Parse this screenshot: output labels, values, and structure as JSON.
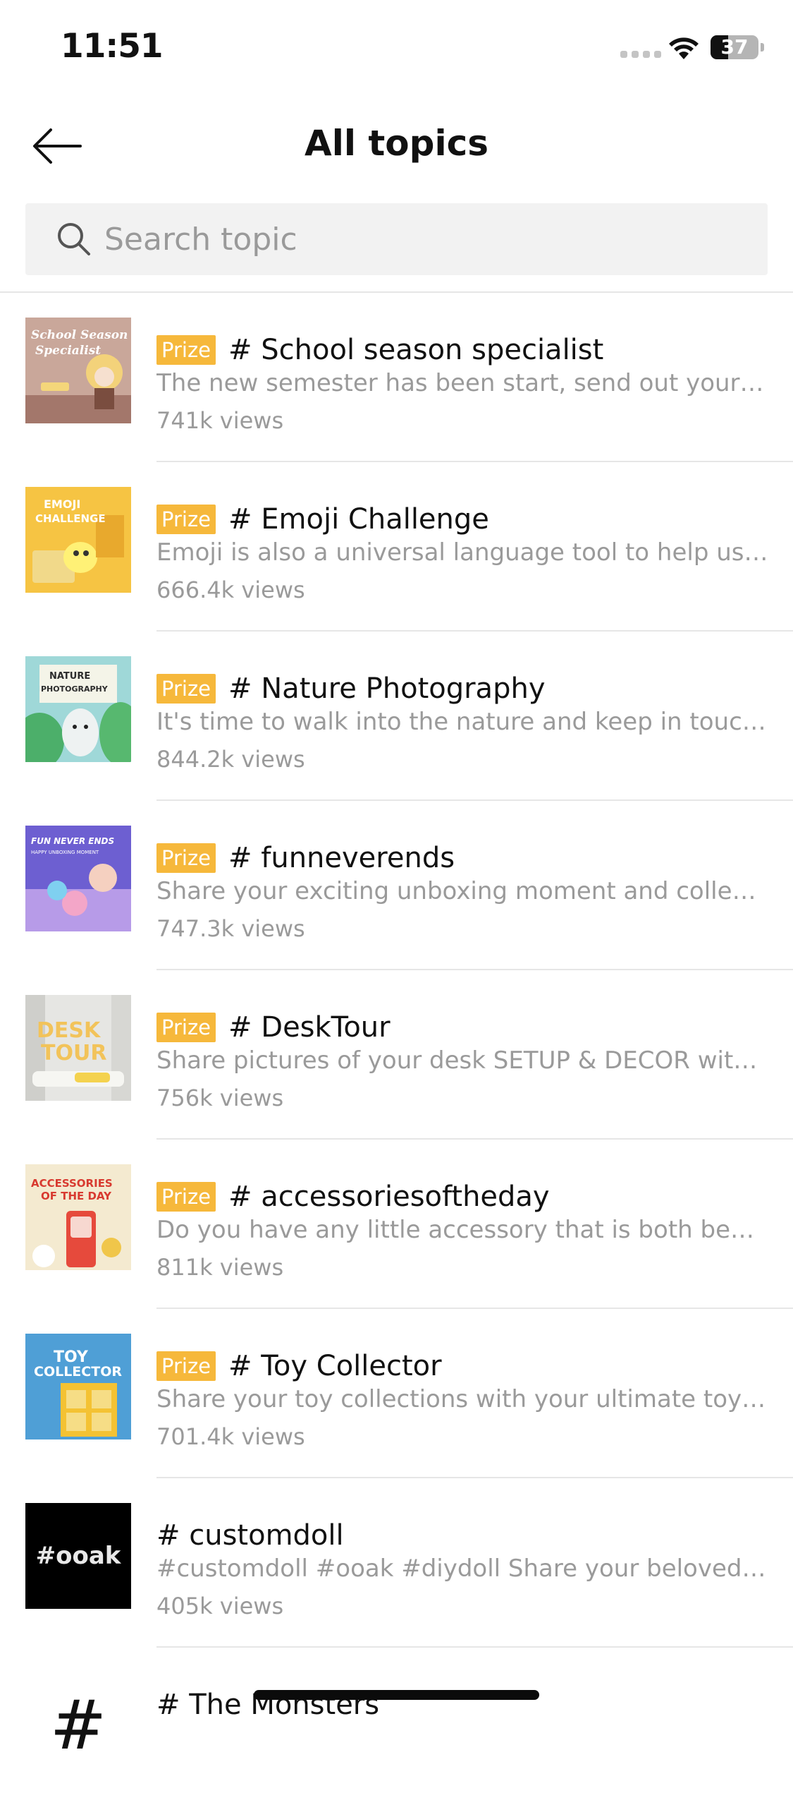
{
  "status_bar": {
    "time": "11:51",
    "battery_level": "37"
  },
  "header": {
    "title": "All topics"
  },
  "search": {
    "placeholder": "Search topic",
    "value": ""
  },
  "colors": {
    "prize_badge": "#f6b83b",
    "secondary_text": "#9a9a9a",
    "divider": "#e6e6e6"
  },
  "topics": [
    {
      "prize": "Prize",
      "title": "# School season specialist",
      "description": "The new semester has been start, send out your first plan for the new semester",
      "views": "741k views",
      "thumb_text": [
        "School Season",
        "Specialist"
      ]
    },
    {
      "prize": "Prize",
      "title": "# Emoji Challenge",
      "description": "Emoji is also a universal language tool to help us express our feelings",
      "views": "666.4k views",
      "thumb_text": [
        "EMOJI",
        "CHALLENGE"
      ]
    },
    {
      "prize": "Prize",
      "title": "# Nature Photography",
      "description": "It's time to walk into the nature and keep in touch with the world around",
      "views": "844.2k views",
      "thumb_text": [
        "NATURE",
        "PHOTOGRAPHY"
      ]
    },
    {
      "prize": "Prize",
      "title": "# funneverends",
      "description": "Share your exciting unboxing moment and collectible moments with us",
      "views": "747.3k views",
      "thumb_text": [
        "FUN NEVER ENDS",
        "HAPPY UNBOXING MOMENT"
      ]
    },
    {
      "prize": "Prize",
      "title": "# DeskTour",
      "description": "Share pictures of your desk SETUP & DECOR with us and everyone",
      "views": "756k views",
      "thumb_text": [
        "DESK",
        "TOUR"
      ]
    },
    {
      "prize": "Prize",
      "title": "# accessoriesoftheday",
      "description": "Do you have any little accessory that is both beautiful and useful",
      "views": "811k views",
      "thumb_text": [
        "ACCESSORIES",
        "OF THE DAY"
      ]
    },
    {
      "prize": "Prize",
      "title": "# Toy Collector",
      "description": "Share your toy collections with your ultimate toy display cabinets",
      "views": "701.4k views",
      "thumb_text": [
        "TOY",
        "COLLECTOR"
      ]
    },
    {
      "prize": "",
      "title": "# customdoll",
      "description": "#customdoll #ooak #diydoll Share your beloved custom dolls with everyone",
      "views": "405k views",
      "thumb_text": [
        "#ooak"
      ]
    },
    {
      "prize": "",
      "title": "# The Monsters",
      "description": "",
      "views": "",
      "thumb_text": [
        "#"
      ]
    }
  ]
}
